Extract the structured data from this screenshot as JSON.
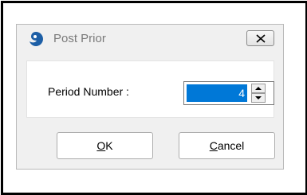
{
  "dialog": {
    "title": "Post Prior",
    "app_icon": "app-logo-icon",
    "close_icon": "close-icon"
  },
  "form": {
    "period_label": "Period Number :",
    "period_value": "4",
    "spin_up_icon": "arrow-up-icon",
    "spin_down_icon": "arrow-down-icon"
  },
  "buttons": {
    "ok": {
      "access_key": "O",
      "rest": "K"
    },
    "cancel": {
      "access_key": "C",
      "rest": "ancel"
    }
  },
  "colors": {
    "selection": "#0078d7",
    "dialog_bg": "#f0f0f0",
    "frame": "#000000"
  }
}
